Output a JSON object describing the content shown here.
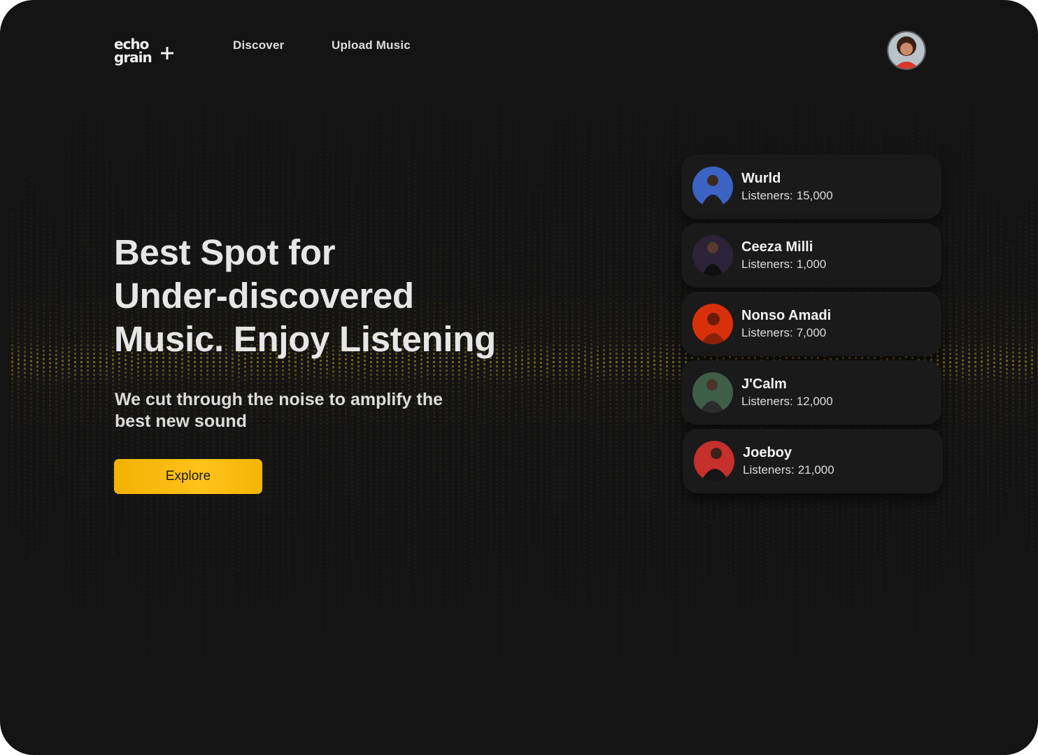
{
  "nav": {
    "logo_line1": "echo",
    "logo_line2": "grain",
    "links": [
      "Discover",
      "Upload Music"
    ]
  },
  "hero": {
    "title_lines": [
      "Best Spot for",
      "Under-discovered",
      "Music. Enjoy Listening"
    ],
    "subtitle": "We cut through the noise to amplify the best new sound",
    "cta_label": "Explore"
  },
  "artists": {
    "listeners_label": "Listeners:",
    "items": [
      {
        "name": "Wurld",
        "listeners": "15,000",
        "photo_color": "#3b63c4"
      },
      {
        "name": "Ceeza Milli",
        "listeners": "1,000",
        "photo_color": "#2b2338"
      },
      {
        "name": "Nonso Amadi",
        "listeners": "7,000",
        "photo_color": "#d9300c"
      },
      {
        "name": "J'Calm",
        "listeners": "12,000",
        "photo_color": "#3f5e48"
      },
      {
        "name": "Joeboy",
        "listeners": "21,000",
        "photo_color": "#c52f2c"
      }
    ]
  },
  "colors": {
    "background": "#141414",
    "accent": "#ffc21a",
    "card": "#1a1a1a"
  }
}
